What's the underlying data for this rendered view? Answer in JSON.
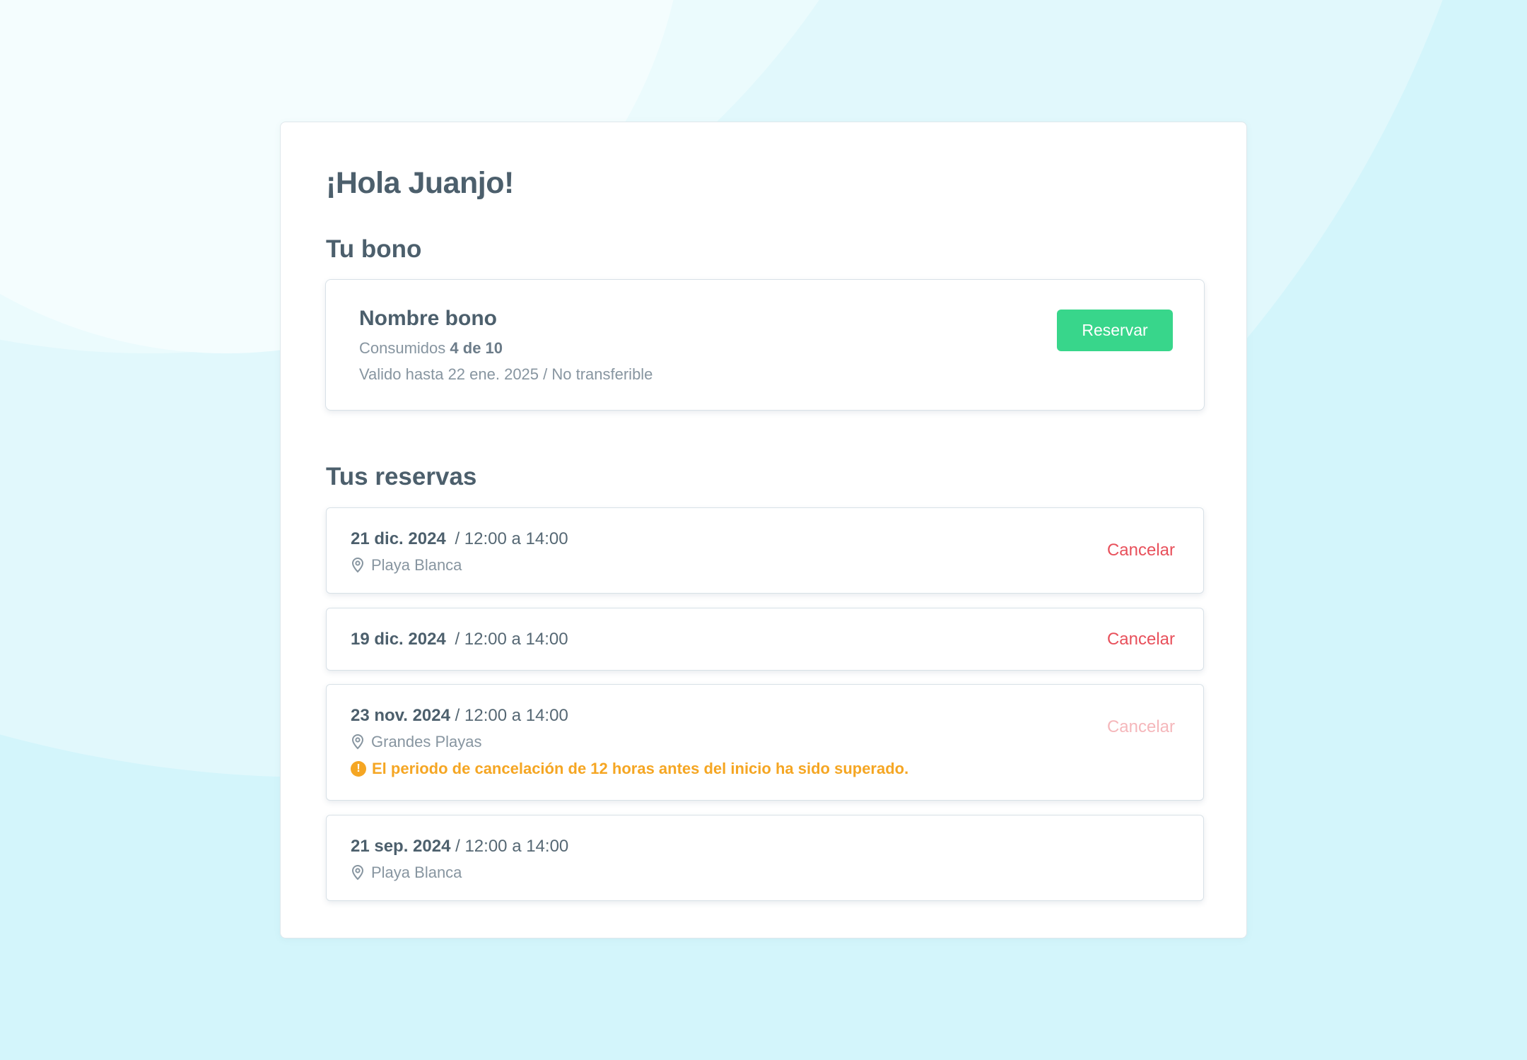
{
  "greeting": "¡Hola Juanjo!",
  "bono_section": {
    "title": "Tu bono",
    "name": "Nombre bono",
    "consumed_label": "Consumidos",
    "consumed_value": "4 de 10",
    "validity": "Valido hasta 22 ene. 2025 / No transferible",
    "reserve_button": "Reservar"
  },
  "reservas_section": {
    "title": "Tus reservas",
    "cancel_label": "Cancelar",
    "items": [
      {
        "date": "21 dic. 2024",
        "time": "/ 12:00 a 14:00",
        "location": "Playa Blanca",
        "cancellable": true
      },
      {
        "date": "19 dic. 2024",
        "time": "/ 12:00 a 14:00",
        "location": "",
        "cancellable": true
      },
      {
        "date": "23 nov. 2024",
        "time": "/ 12:00 a 14:00",
        "location": "Grandes Playas",
        "cancellable": false,
        "warning": "El periodo de cancelación de 12 horas antes del inicio ha sido superado."
      },
      {
        "date": "21 sep. 2024",
        "time": "/ 12:00 a 14:00",
        "location": "Playa Blanca",
        "cancellable": false
      }
    ]
  },
  "colors": {
    "accent_green": "#38d68b",
    "cancel_red": "#e8505b",
    "warning_orange": "#f5a623",
    "text_dark": "#4c5f6c"
  },
  "icons": {
    "location": "map-pin-icon",
    "warning": "exclamation-circle-icon"
  }
}
